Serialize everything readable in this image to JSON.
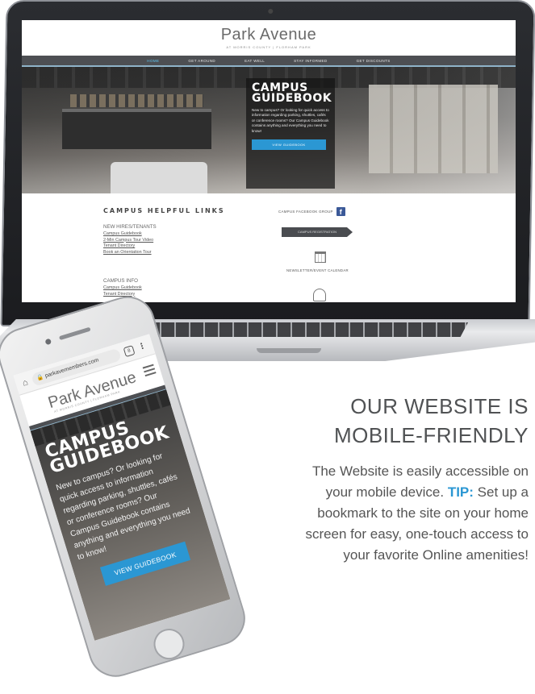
{
  "laptop_site": {
    "logo": "Park Avenue",
    "logo_sub": "AT MORRIS COUNTY | FLORHAM PARK",
    "nav": [
      "HOME",
      "GET AROUND",
      "EAT WELL",
      "STAY INFORMED",
      "GET DISCOUNTS"
    ],
    "hero": {
      "title_line1": "CAMPUS",
      "title_line2": "GUIDEBOOK",
      "text": "New to campus? Or looking for quick access to information regarding parking, shuttles, cafés or conference rooms? Our Campus Guidebook contains anything and everything you need to know!",
      "button": "VIEW GUIDEBOOK"
    },
    "links": {
      "title": "CAMPUS HELPFUL LINKS",
      "groups": [
        {
          "heading": "NEW HIRES/TENANTS",
          "items": [
            "Campus Guidebook",
            "2-Min Campus Tour Video",
            "Tenant Directory",
            "Book an Orientation Tour"
          ]
        },
        {
          "heading": "CAMPUS INFO",
          "items": [
            "Campus Guidebook",
            "Tenant Directory"
          ]
        }
      ]
    },
    "sidebar": {
      "facebook_label": "CAMPUS FACEBOOK GROUP",
      "facebook_glyph": "f",
      "registration_button": "CAMPUS REGISTRATION",
      "calendar_label": "NEWSLETTER/EVENT CALENDAR"
    }
  },
  "mobile_site": {
    "url": "parkavemembers.com",
    "tab_count": "8",
    "logo": "Park Avenue",
    "logo_sub": "AT MORRIS COUNTY | FLORHAM PARK",
    "hero": {
      "title_line1": "CAMPUS",
      "title_line2": "GUIDEBOOK",
      "text": "New to campus? Or looking for quick access to information regarding parking, shuttles, cafés or conference rooms? Our Campus Guidebook contains anything and everything you need to know!",
      "button": "VIEW GUIDEBOOK"
    }
  },
  "copy": {
    "heading_line1": "OUR WEBSITE IS",
    "heading_line2": "MOBILE-FRIENDLY",
    "body_before": "The Website is easily accessible on your mobile device.",
    "tip_label": "TIP:",
    "body_after": "Set up a bookmark to the site on your home screen for easy, one-touch access to your favorite Online amenities!"
  },
  "colors": {
    "accent_blue": "#2b97d3",
    "nav_gray": "#4d4f53",
    "facebook_blue": "#3b5998"
  }
}
